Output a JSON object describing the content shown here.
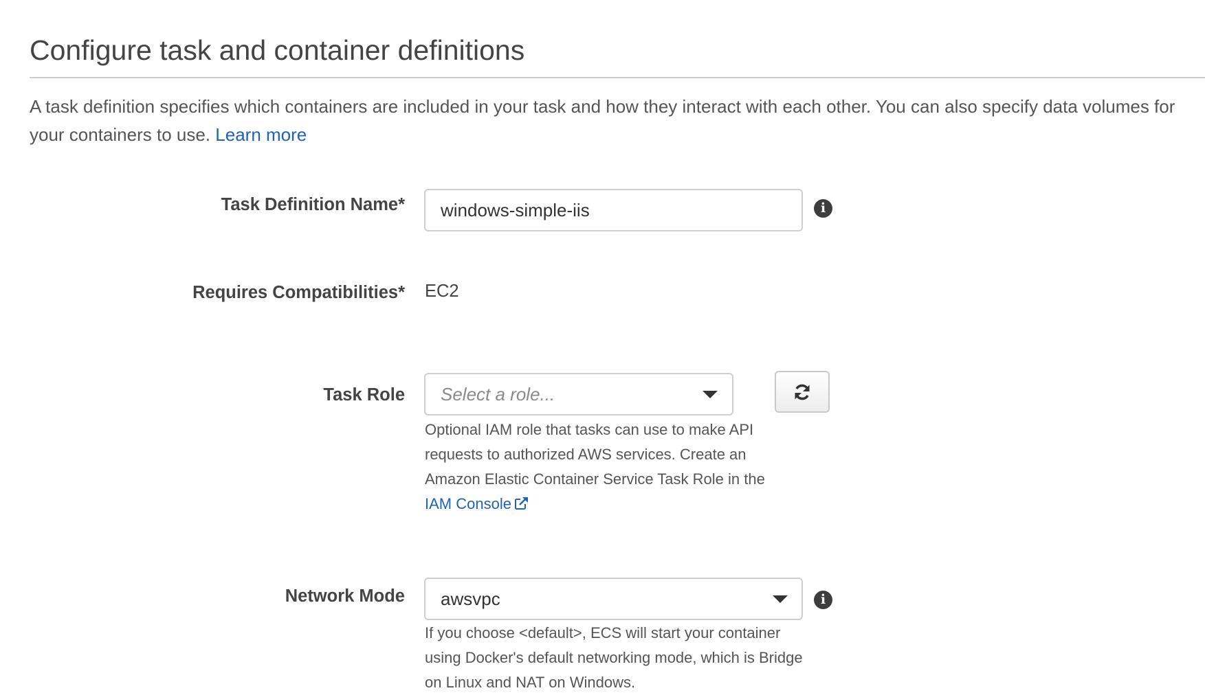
{
  "header": {
    "title": "Configure task and container definitions",
    "description": "A task definition specifies which containers are included in your task and how they interact with each other. You can also specify data volumes for your containers to use.",
    "learn_more_label": "Learn more"
  },
  "form": {
    "task_definition_name": {
      "label": "Task Definition Name*",
      "value": "windows-simple-iis",
      "info_icon": "info-circle-icon"
    },
    "requires_compatibilities": {
      "label": "Requires Compatibilities*",
      "value": "EC2"
    },
    "task_role": {
      "label": "Task Role",
      "placeholder": "Select a role...",
      "refresh_icon": "refresh-icon",
      "help_text": "Optional IAM role that tasks can use to make API requests to authorized AWS services. Create an Amazon Elastic Container Service Task Role in the",
      "help_link_label": "IAM Console",
      "help_link_icon": "external-link-icon"
    },
    "network_mode": {
      "label": "Network Mode",
      "value": "awsvpc",
      "info_icon": "info-circle-icon",
      "help_text": "If you choose <default>, ECS will start your container using Docker's default networking mode, which is Bridge on Linux and NAT on Windows."
    }
  },
  "colors": {
    "link": "#1f62b8",
    "text": "#444444",
    "muted_text": "#555555",
    "border": "#cfcfcf",
    "divider": "#cccccc"
  }
}
